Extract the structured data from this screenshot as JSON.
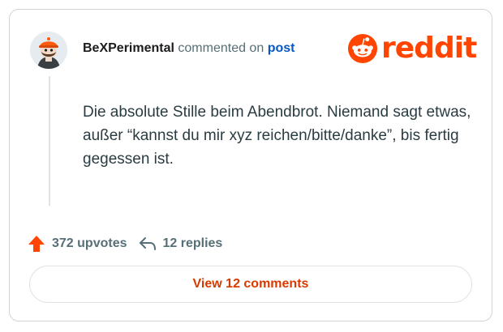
{
  "comment": {
    "author": "BeXPerimental",
    "action_text": "commented on",
    "post_link": "post",
    "body": "Die absolute Stille beim Abendbrot. Niemand sagt etwas, außer “kannst du mir xyz reichen/bitte/danke”, bis fertig gegessen ist."
  },
  "brand": {
    "name": "reddit",
    "color": "#ff4500"
  },
  "stats": {
    "upvotes": "372 upvotes",
    "replies": "12 replies"
  },
  "actions": {
    "view_comments_label": "View 12 comments"
  },
  "icons": {
    "upvote": "upvote-arrow-icon",
    "reply": "reply-arrow-icon",
    "logo": "reddit-snoo-icon",
    "avatar": "user-avatar"
  },
  "colors": {
    "accent": "#ff4500",
    "link": "#0a57c2",
    "muted": "#576f76",
    "button_text": "#d93a00"
  }
}
